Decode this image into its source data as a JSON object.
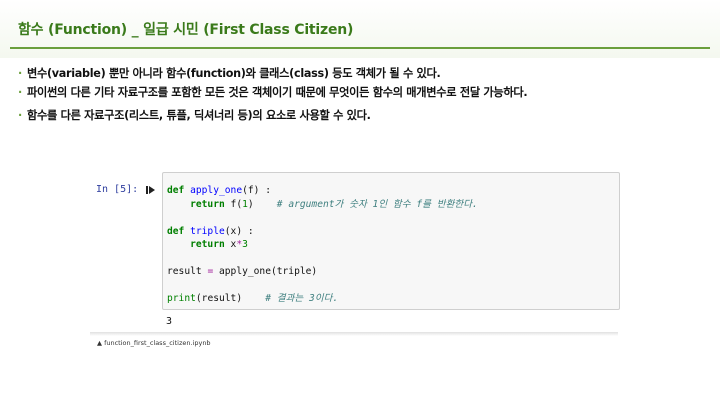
{
  "header": {
    "title": "함수 (Function) _ 일급 시민 (First Class Citizen)"
  },
  "bullets": {
    "marker": "·",
    "items": [
      "변수(variable) 뿐만 아니라 함수(function)와 클래스(class) 등도 객체가 될 수 있다.",
      "파이썬의 다른 기타 자료구조를 포함한 모든 것은 객체이기 때문에 무엇이든 함수의 매개변수로 전달 가능하다.",
      "함수를 다른 자료구조(리스트, 튜플, 딕셔너리 등)의 요소로 사용할 수 있다."
    ]
  },
  "notebook": {
    "prompt": "In [5]:",
    "run_icon": "play-icon",
    "code": {
      "l1_def": "def",
      "l1_name": "apply_one",
      "l1_rest": "(f) :",
      "l2_ret": "return",
      "l2_call": " f(",
      "l2_num": "1",
      "l2_close": ")",
      "l2_comment": "# argument가 숫자 1인 함수 f를 반환한다.",
      "l3_def": "def",
      "l3_name": "triple",
      "l3_rest": "(x) :",
      "l4_ret": "return",
      "l4_x": " x",
      "l4_op": "*",
      "l4_num": "3",
      "l5_var": "result ",
      "l5_op": "=",
      "l5_call": " apply_one(triple)",
      "l6_print": "print",
      "l6_args": "(result)",
      "l6_comment": "# 결과는 3이다."
    },
    "output": "3"
  },
  "caption": "▲ function_first_class_citizen.ipynb",
  "colors": {
    "title": "#3a7a1a",
    "rule": "#6a9f3c",
    "keyword": "#007f00",
    "function_name": "#0000ff",
    "comment": "#408080",
    "prompt": "#303f9f"
  }
}
